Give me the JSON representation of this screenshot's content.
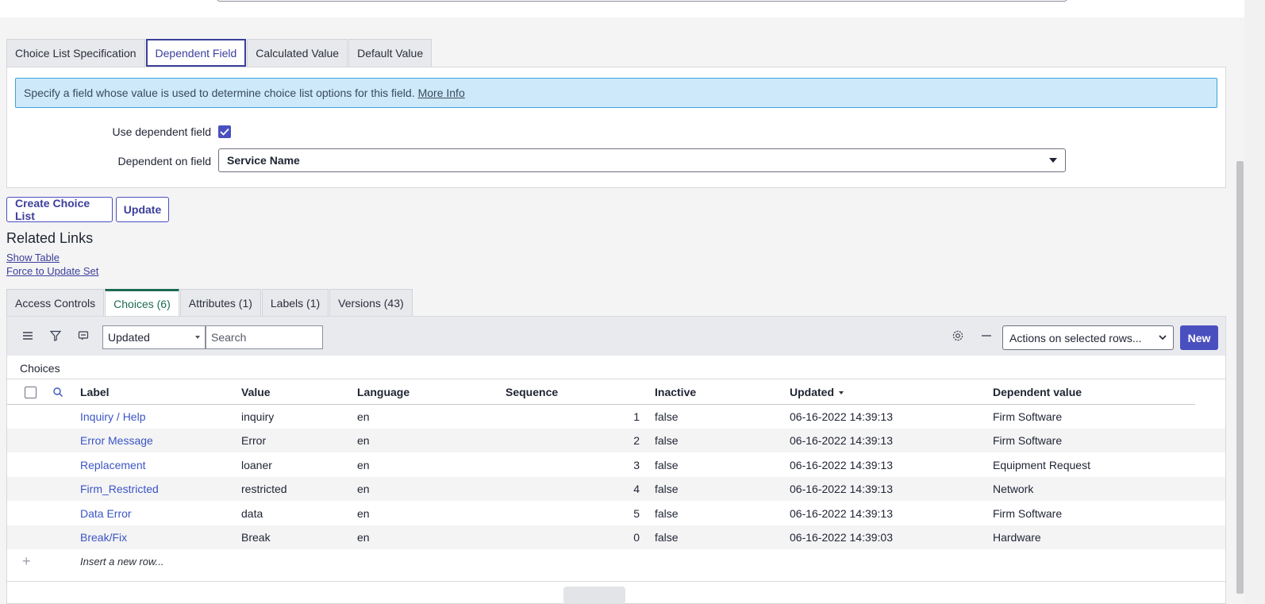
{
  "form_tabs": [
    {
      "label": "Choice List Specification"
    },
    {
      "label": "Dependent Field"
    },
    {
      "label": "Calculated Value"
    },
    {
      "label": "Default Value"
    }
  ],
  "info": {
    "text": "Specify a field whose value is used to determine choice list options for this field.",
    "link": "More Info"
  },
  "form": {
    "use_dependent_label": "Use dependent field",
    "use_dependent_checked": true,
    "dependent_on_label": "Dependent on field",
    "dependent_on_value": "Service Name"
  },
  "buttons": {
    "create_choice_list": "Create Choice List",
    "update": "Update"
  },
  "related_links": {
    "title": "Related Links",
    "links": [
      "Show Table",
      "Force to Update Set"
    ]
  },
  "related_tabs": [
    {
      "label": "Access Controls"
    },
    {
      "label": "Choices (6)"
    },
    {
      "label": "Attributes (1)"
    },
    {
      "label": "Labels (1)"
    },
    {
      "label": "Versions (43)"
    }
  ],
  "list": {
    "toolbar": {
      "filter_select": "Updated",
      "search_placeholder": "Search",
      "actions": "Actions on selected rows...",
      "new": "New"
    },
    "caption": "Choices",
    "columns": [
      "Label",
      "Value",
      "Language",
      "Sequence",
      "Inactive",
      "Updated",
      "Dependent value"
    ],
    "rows": [
      {
        "label": "Inquiry / Help",
        "value": "inquiry",
        "language": "en",
        "sequence": "1",
        "inactive": "false",
        "updated": "06-16-2022 14:39:13",
        "dependent": "Firm Software"
      },
      {
        "label": "Error Message",
        "value": "Error",
        "language": "en",
        "sequence": "2",
        "inactive": "false",
        "updated": "06-16-2022 14:39:13",
        "dependent": "Firm Software"
      },
      {
        "label": "Replacement",
        "value": "loaner",
        "language": "en",
        "sequence": "3",
        "inactive": "false",
        "updated": "06-16-2022 14:39:13",
        "dependent": "Equipment Request"
      },
      {
        "label": "Firm_Restricted",
        "value": "restricted",
        "language": "en",
        "sequence": "4",
        "inactive": "false",
        "updated": "06-16-2022 14:39:13",
        "dependent": "Network"
      },
      {
        "label": "Data Error",
        "value": "data",
        "language": "en",
        "sequence": "5",
        "inactive": "false",
        "updated": "06-16-2022 14:39:13",
        "dependent": "Firm Software"
      },
      {
        "label": "Break/Fix",
        "value": "Break",
        "language": "en",
        "sequence": "0",
        "inactive": "false",
        "updated": "06-16-2022 14:39:03",
        "dependent": "Hardware"
      }
    ],
    "insert_row": "Insert a new row..."
  },
  "colors": {
    "accent": "#4a4fbf",
    "info_bg": "#cde9fa",
    "tab_green": "#1c6b52"
  }
}
